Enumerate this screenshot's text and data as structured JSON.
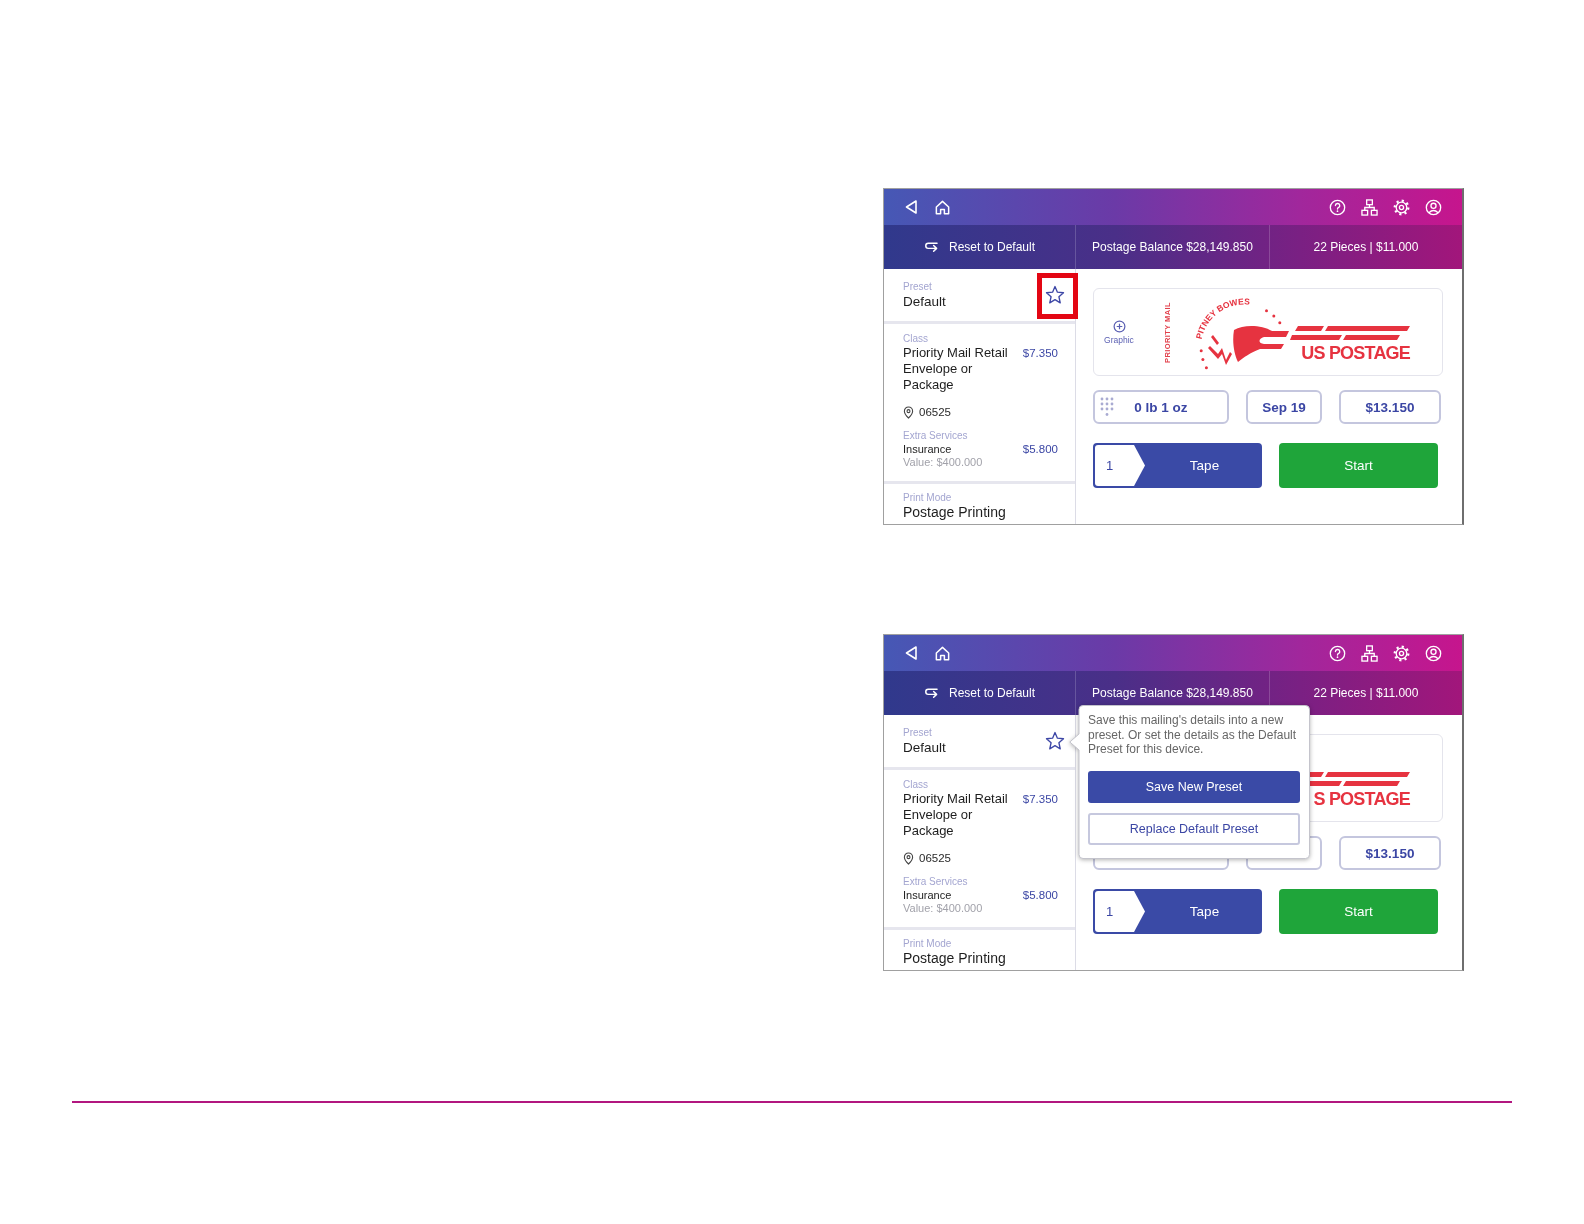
{
  "screens": [
    {
      "toolbar": {
        "reset_label": "Reset to Default",
        "balance": "Postage Balance $28,149.850",
        "pieces": "22 Pieces | $11.000"
      },
      "preset": {
        "label": "Preset",
        "value": "Default",
        "highlighted": true
      },
      "class": {
        "label": "Class",
        "name": "Priority Mail Retail Envelope or Package",
        "price": "$7.350",
        "zip": "06525"
      },
      "extra_services": {
        "label": "Extra Services",
        "name": "Insurance",
        "price": "$5.800",
        "value": "Value: $400.000"
      },
      "print_mode": {
        "label": "Print Mode",
        "value": "Postage Printing"
      },
      "stamp": {
        "graphic_label": "Graphic",
        "side_text": "PRIORITY MAIL",
        "arc_text": "PITNEY BOWES",
        "postage_text": "US POSTAGE"
      },
      "fields": [
        {
          "kind": "weight",
          "value": "0 lb 1 oz"
        },
        {
          "kind": "date",
          "value": "Sep 19"
        },
        {
          "kind": "amount",
          "value": "$13.150"
        }
      ],
      "copies": "1",
      "mode_button": "Tape",
      "start_button": "Start"
    },
    {
      "toolbar": {
        "reset_label": "Reset to Default",
        "balance": "Postage Balance $28,149.850",
        "pieces": "22 Pieces | $11.000"
      },
      "preset": {
        "label": "Preset",
        "value": "Default",
        "highlighted": false
      },
      "class": {
        "label": "Class",
        "name": "Priority Mail Retail Envelope or Package",
        "price": "$7.350",
        "zip": "06525"
      },
      "extra_services": {
        "label": "Extra Services",
        "name": "Insurance",
        "price": "$5.800",
        "value": "Value: $400.000"
      },
      "print_mode": {
        "label": "Print Mode",
        "value": "Postage Printing"
      },
      "stamp": {
        "postage_text": "S POSTAGE"
      },
      "fields": [
        {
          "kind": "weight"
        },
        {
          "kind": "date"
        },
        {
          "kind": "amount",
          "value": "$13.150"
        }
      ],
      "copies": "1",
      "mode_button": "Tape",
      "start_button": "Start",
      "popover": {
        "message": "Save this mailing's details into a new preset. Or set the details as the Default Preset for this device.",
        "buttons": [
          {
            "kind": "primary",
            "label": "Save New Preset"
          },
          {
            "kind": "secondary",
            "label": "Replace Default Preset"
          }
        ]
      }
    }
  ]
}
